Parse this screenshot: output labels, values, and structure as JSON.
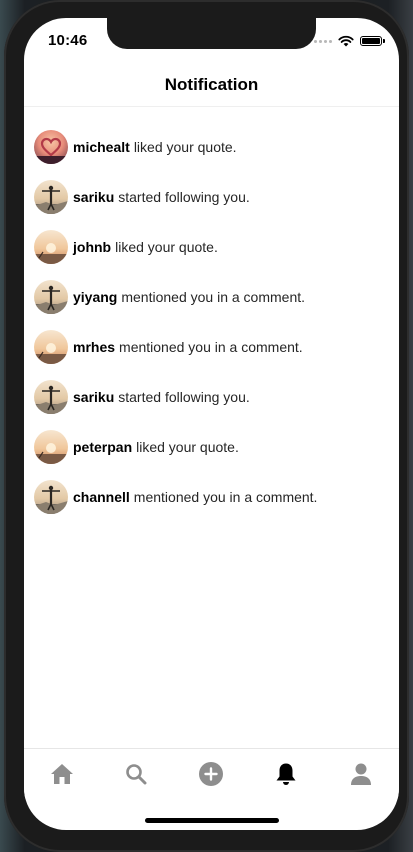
{
  "status_bar": {
    "time": "10:46"
  },
  "header": {
    "title": "Notification"
  },
  "notifications": [
    {
      "username": "michealt",
      "action": "liked your quote.",
      "avatar": "heart"
    },
    {
      "username": "sariku",
      "action": "started following you.",
      "avatar": "person"
    },
    {
      "username": "johnb",
      "action": "liked your quote.",
      "avatar": "sunset"
    },
    {
      "username": "yiyang",
      "action": "mentioned you in a comment.",
      "avatar": "person"
    },
    {
      "username": "mrhes",
      "action": "mentioned you in a comment.",
      "avatar": "sunset"
    },
    {
      "username": "sariku",
      "action": "started following you.",
      "avatar": "person"
    },
    {
      "username": "peterpan",
      "action": "liked your quote.",
      "avatar": "sunset"
    },
    {
      "username": "channell",
      "action": "mentioned you in a comment.",
      "avatar": "person"
    }
  ],
  "tabs": [
    {
      "icon": "home-icon",
      "active": false
    },
    {
      "icon": "search-icon",
      "active": false
    },
    {
      "icon": "add-icon",
      "active": false
    },
    {
      "icon": "bell-icon",
      "active": true
    },
    {
      "icon": "profile-icon",
      "active": false
    }
  ],
  "colors": {
    "tab_inactive": "#8e8e8e",
    "tab_active": "#000000",
    "text": "#262626"
  }
}
